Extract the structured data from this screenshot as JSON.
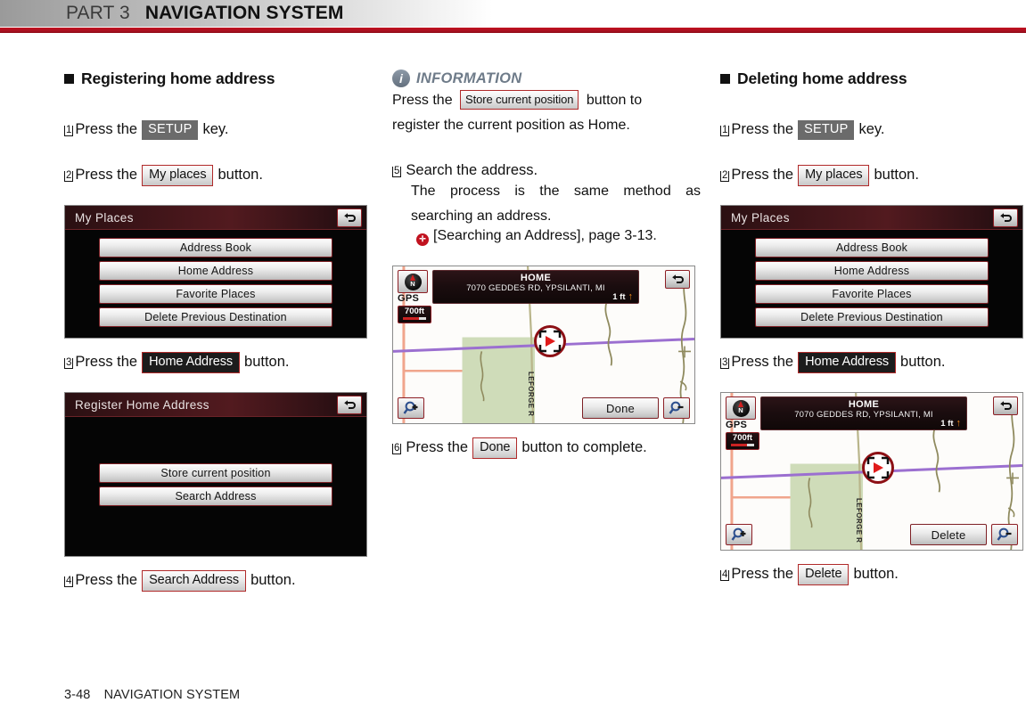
{
  "header": {
    "part_label": "PART 3",
    "part_title": "NAVIGATION SYSTEM"
  },
  "footer": {
    "page_number": "3-48",
    "section": "NAVIGATION SYSTEM"
  },
  "left_column": {
    "heading": "Registering home address",
    "steps": [
      {
        "num": "1",
        "pre": "Press the",
        "chip": "SETUP",
        "chip_style": "gray",
        "post": "key."
      },
      {
        "num": "2",
        "pre": "Press the",
        "chip": "My places",
        "chip_style": "light",
        "post": "button."
      },
      {
        "num": "3",
        "pre": "Press the",
        "chip": "Home Address",
        "chip_style": "dark",
        "post": "button."
      },
      {
        "num": "4",
        "pre": "Press the",
        "chip": "Search Address",
        "chip_style": "light",
        "post": "button."
      }
    ],
    "my_places_screen": {
      "title": "My Places",
      "back_icon": "back-arrow-icon",
      "buttons": [
        "Address Book",
        "Home Address",
        "Favorite Places",
        "Delete Previous Destination"
      ]
    },
    "register_screen": {
      "title": "Register Home Address",
      "back_icon": "back-arrow-icon",
      "buttons": [
        "Store current position",
        "Search Address"
      ]
    }
  },
  "middle_column": {
    "information": {
      "icon": "info-icon",
      "title": "INFORMATION",
      "text_pre": "Press  the",
      "chip": "Store current position",
      "text_post": "button  to",
      "text_line2": "register the current position as Home."
    },
    "step5": {
      "num": "5",
      "text": "Search the address.",
      "sub": "The  process  is  the  same  method  as searching an address.",
      "ref_icon": "page-reference-icon",
      "ref": "[Searching an Address], page 3-13."
    },
    "map_screen": {
      "compass_label": "N",
      "gps_label": "GPS",
      "scale": "700ft",
      "title": "HOME",
      "address": "7070 GEDDES RD, YPSILANTI, MI",
      "distance": "1 ft",
      "distance_arrow": "↑",
      "street_label": "LEFORGE R",
      "zoom_in_icon": "magnifier-plus-icon",
      "zoom_out_icon": "magnifier-minus-icon",
      "back_icon": "back-arrow-icon",
      "action_button": "Done"
    },
    "step6": {
      "num": "6",
      "pre": "Press the",
      "chip": "Done",
      "post": "button to complete."
    }
  },
  "right_column": {
    "heading": "Deleting home address",
    "steps": [
      {
        "num": "1",
        "pre": "Press the",
        "chip": "SETUP",
        "chip_style": "gray",
        "post": "key."
      },
      {
        "num": "2",
        "pre": "Press the",
        "chip": "My places",
        "chip_style": "light",
        "post": "button."
      },
      {
        "num": "3",
        "pre": "Press the",
        "chip": "Home Address",
        "chip_style": "dark",
        "post": "button."
      },
      {
        "num": "4",
        "pre": "Press the",
        "chip": "Delete",
        "chip_style": "light",
        "post": "button."
      }
    ],
    "my_places_screen": {
      "title": "My Places",
      "back_icon": "back-arrow-icon",
      "buttons": [
        "Address Book",
        "Home Address",
        "Favorite Places",
        "Delete Previous Destination"
      ]
    },
    "map_screen": {
      "compass_label": "N",
      "gps_label": "GPS",
      "scale": "700ft",
      "title": "HOME",
      "address": "7070 GEDDES RD, YPSILANTI, MI",
      "distance": "1 ft",
      "distance_arrow": "↑",
      "street_label": "LEFORGE R",
      "zoom_in_icon": "magnifier-plus-icon",
      "zoom_out_icon": "magnifier-minus-icon",
      "back_icon": "back-arrow-icon",
      "action_button": "Delete"
    }
  },
  "colors": {
    "brand_red": "#c1121f",
    "screen_dark": "#050505",
    "info_blue_gray": "#6e7b89"
  }
}
